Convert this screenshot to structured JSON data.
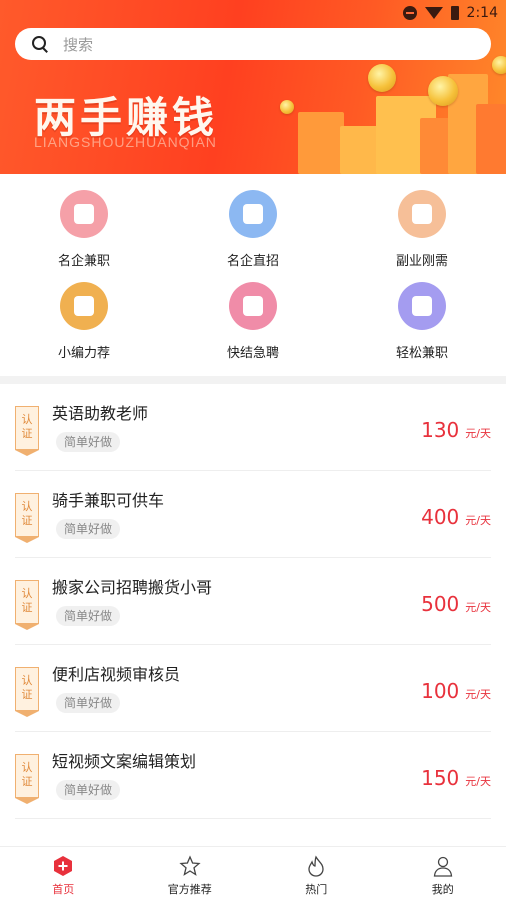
{
  "status_bar": {
    "time": "2:14"
  },
  "search": {
    "placeholder": "搜索"
  },
  "banner": {
    "slogan": "两手赚钱",
    "slogan_sub": "LIANGSHOUZHUANQIAN"
  },
  "categories": [
    {
      "label": "名企兼职",
      "icon": "wallet-icon",
      "color": "#f5a0a8"
    },
    {
      "label": "名企直招",
      "icon": "building-icon",
      "color": "#8cb8f2"
    },
    {
      "label": "副业刚需",
      "icon": "folder-icon",
      "color": "#f6bf98"
    },
    {
      "label": "小编力荐",
      "icon": "bookmark-icon",
      "color": "#f0b050"
    },
    {
      "label": "快结急聘",
      "icon": "money-bag-icon",
      "color": "#f08ca8"
    },
    {
      "label": "轻松兼职",
      "icon": "clock-icon",
      "color": "#a49cf0"
    }
  ],
  "jobs": [
    {
      "badge": [
        "认",
        "证"
      ],
      "title": "英语助教老师",
      "tag": "简单好做",
      "amount": "130",
      "unit": "元/天"
    },
    {
      "badge": [
        "认",
        "证"
      ],
      "title": "骑手兼职可供车",
      "tag": "简单好做",
      "amount": "400",
      "unit": "元/天"
    },
    {
      "badge": [
        "认",
        "证"
      ],
      "title": "搬家公司招聘搬货小哥",
      "tag": "简单好做",
      "amount": "500",
      "unit": "元/天"
    },
    {
      "badge": [
        "认",
        "证"
      ],
      "title": "便利店视频审核员",
      "tag": "简单好做",
      "amount": "100",
      "unit": "元/天"
    },
    {
      "badge": [
        "认",
        "证"
      ],
      "title": "短视频文案编辑策划",
      "tag": "简单好做",
      "amount": "150",
      "unit": "元/天"
    }
  ],
  "nav": [
    {
      "label": "首页",
      "icon": "home-icon",
      "active": true
    },
    {
      "label": "官方推荐",
      "icon": "star-icon",
      "active": false
    },
    {
      "label": "热门",
      "icon": "flame-icon",
      "active": false
    },
    {
      "label": "我的",
      "icon": "user-icon",
      "active": false
    }
  ],
  "colors": {
    "accent": "#e8313c",
    "banner": "#ff4a22",
    "badge": "#e0893a"
  }
}
